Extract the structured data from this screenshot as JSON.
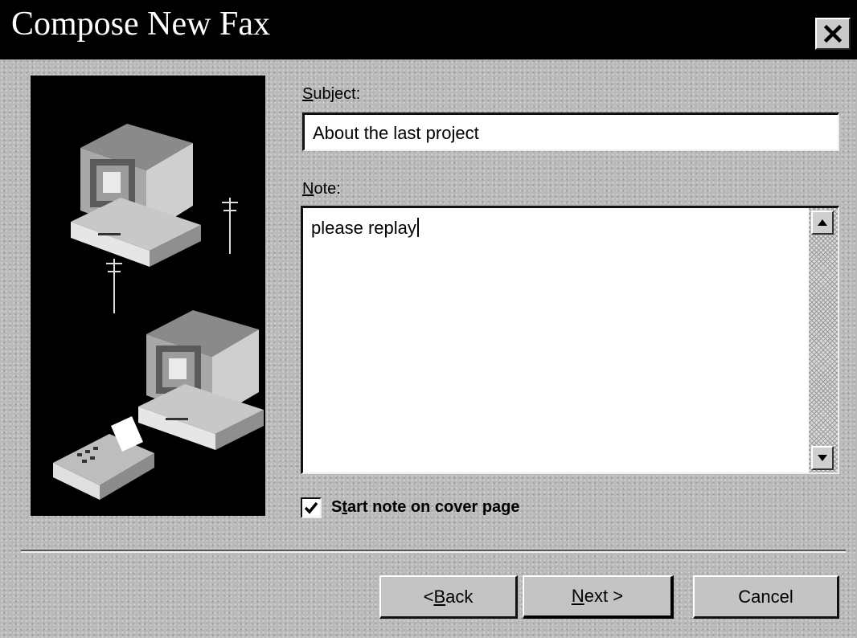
{
  "window": {
    "title": "Compose New Fax",
    "close_label": "×"
  },
  "form": {
    "subject_label": {
      "mnemonic": "S",
      "rest": "ubject:"
    },
    "subject_value": "About the last project",
    "note_label": {
      "mnemonic": "N",
      "rest": "ote:"
    },
    "note_value": "please replay",
    "scroll_up_icon": "scroll-up-arrow",
    "scroll_down_icon": "scroll-down-arrow",
    "cover_page": {
      "checked": true,
      "label_pre": "S",
      "mnemonic": "t",
      "label_post": "art note on cover page"
    }
  },
  "buttons": {
    "back": {
      "pre": "< ",
      "mnemonic": "B",
      "post": "ack"
    },
    "next": {
      "pre": "",
      "mnemonic": "N",
      "post": "ext >"
    },
    "cancel": "Cancel"
  },
  "illustration": {
    "icons": [
      "computer-icon",
      "telephone-pole-icon",
      "computer-icon",
      "fax-machine-icon"
    ]
  }
}
